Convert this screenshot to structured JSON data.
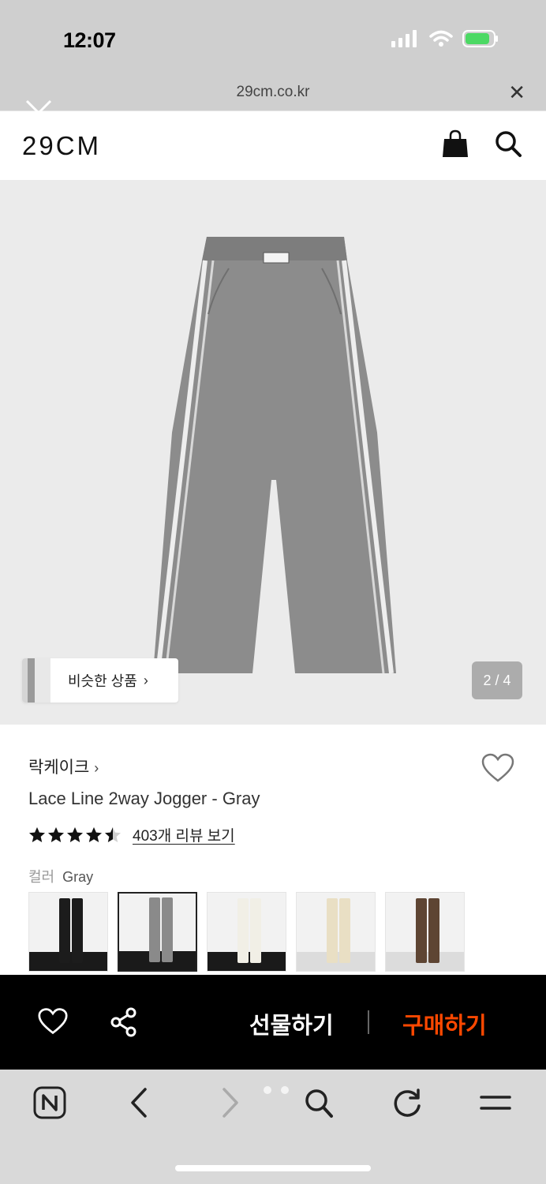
{
  "status_bar": {
    "time": "12:07"
  },
  "browser": {
    "url": "29cm.co.kr"
  },
  "site": {
    "logo": "29CM"
  },
  "gallery": {
    "similar_label": "비슷한 상품",
    "pager": "2 / 4"
  },
  "product": {
    "brand": "락케이크",
    "name": "Lace Line 2way Jogger - Gray",
    "rating_stars": 4.5,
    "review_link": "403개 리뷰 보기",
    "color_label": "컬러",
    "color_value": "Gray",
    "color_options": [
      {
        "name": "black",
        "color": "#1c1c1c"
      },
      {
        "name": "gray",
        "color": "#8a8a8a"
      },
      {
        "name": "ivory",
        "color": "#f1efe6"
      },
      {
        "name": "cream",
        "color": "#e9dfc4"
      },
      {
        "name": "brown",
        "color": "#5e4533"
      }
    ]
  },
  "actions": {
    "gift": "선물하기",
    "buy": "구매하기"
  },
  "colors": {
    "buy_accent": "#ff4800",
    "action_bar_bg": "#000000"
  },
  "icons": [
    "close-icon",
    "bag-icon",
    "search-icon",
    "heart-icon",
    "share-icon",
    "naver-icon",
    "back-icon",
    "forward-icon",
    "reload-icon",
    "menu-icon"
  ]
}
